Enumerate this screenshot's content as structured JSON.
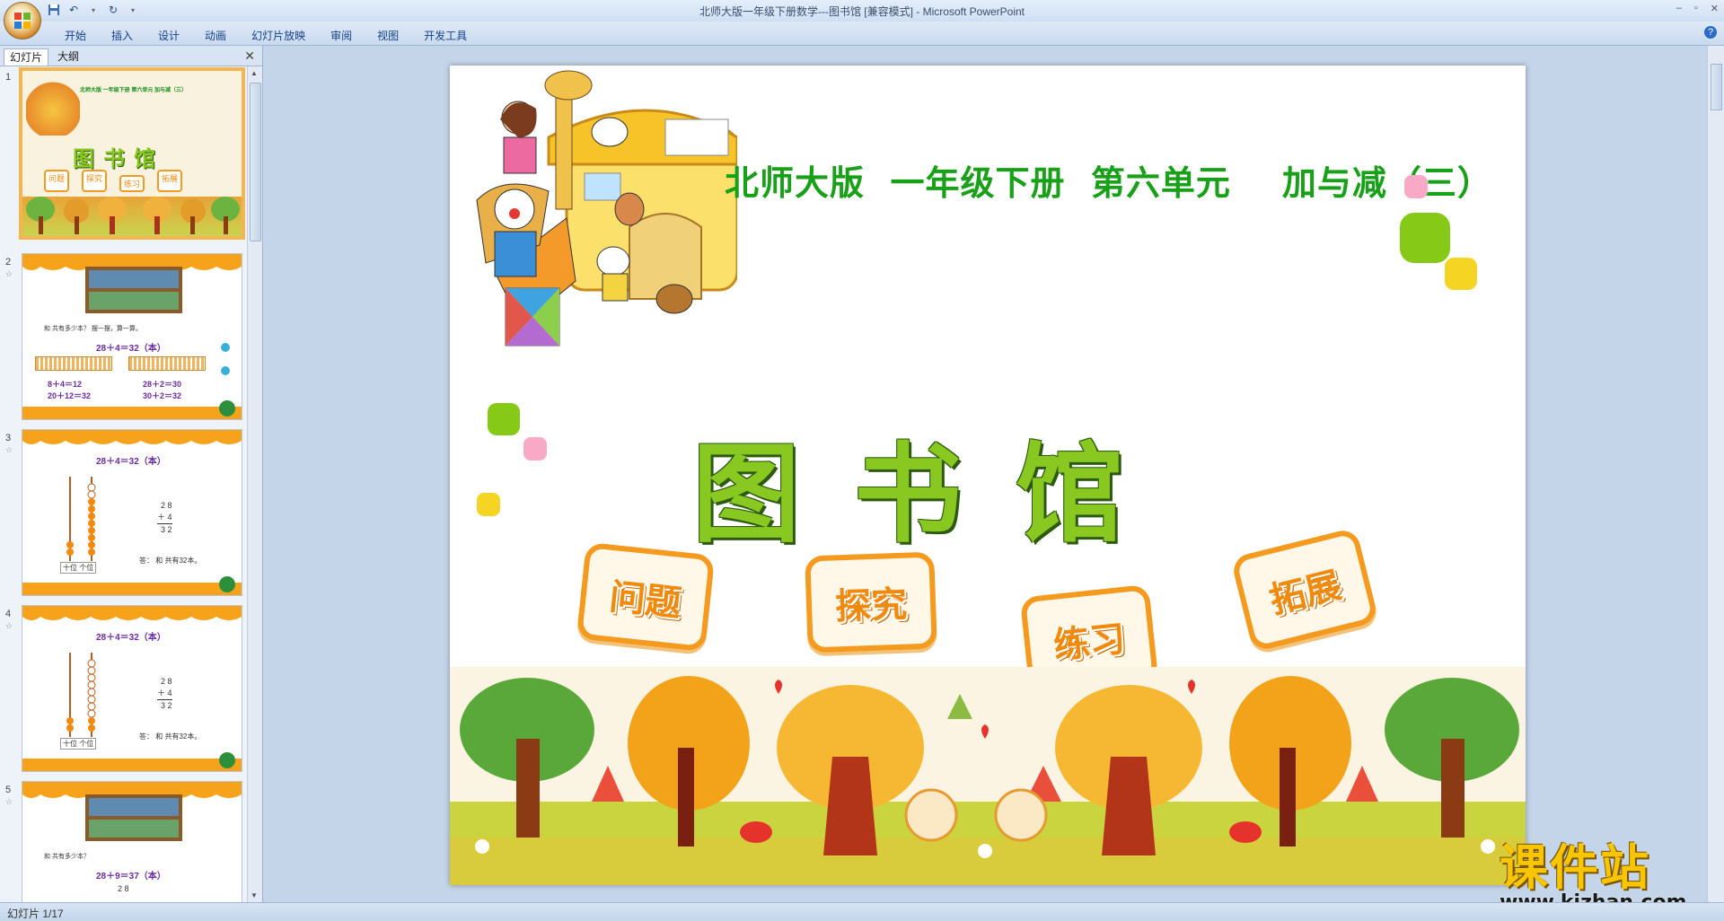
{
  "window": {
    "title": "北师大版一年级下册数学---图书馆 [兼容模式] - Microsoft PowerPoint",
    "controls": [
      "–",
      "▫",
      "✕"
    ]
  },
  "qat": {
    "save_icon": "save-icon",
    "undo_icon": "undo-icon",
    "redo_icon": "redo-icon",
    "customize_icon": "chevron-down-icon"
  },
  "ribbon": {
    "tabs": [
      "开始",
      "插入",
      "设计",
      "动画",
      "幻灯片放映",
      "审阅",
      "视图",
      "开发工具"
    ],
    "help": "?"
  },
  "panel": {
    "tab_slides": "幻灯片",
    "tab_outline": "大纲",
    "close": "✕"
  },
  "thumbnails": [
    {
      "num": "1",
      "title": "图书馆",
      "header": "北师大版 一年级下册 第六单元 加与减（三）",
      "badges": [
        "问题",
        "探究",
        "练习",
        "拓展"
      ]
    },
    {
      "num": "2",
      "line1": "共有多少本？ 摆一摆，算一算。",
      "eq": "28＋4＝32（本）",
      "l1": "8＋4＝12",
      "l2": "20＋12＝32",
      "r1": "28＋2＝30",
      "r2": "30＋2＝32",
      "pre": "和"
    },
    {
      "num": "3",
      "eq": "28＋4＝32（本）",
      "v1": "2 8",
      "v2": "＋ 4",
      "v3": "3 2",
      "ans": "答：  和  共有32本。",
      "place": "十位 个位"
    },
    {
      "num": "4",
      "eq": "28＋4＝32（本）",
      "v1": "2 8",
      "v2": "＋ 4",
      "v3": "3 2",
      "ans": "答：  和  共有32本。",
      "place": "十位 个位"
    },
    {
      "num": "5",
      "line1": "共有多少本？",
      "eq": "28＋9＝37（本）",
      "v1": "2 8",
      "pre": "和"
    }
  ],
  "slide": {
    "subtitle": "北师大版  一年级下册  第六单元    加与减（三）",
    "title": "图书馆",
    "badges": [
      "问题",
      "探究",
      "练习",
      "拓展"
    ],
    "accent_green": "#18a018",
    "badge_orange": "#f49a1e"
  },
  "status": {
    "slide_counter": "幻灯片 1/17"
  },
  "watermark": {
    "brand": "课件站",
    "url": "www.kjzhan.com"
  }
}
